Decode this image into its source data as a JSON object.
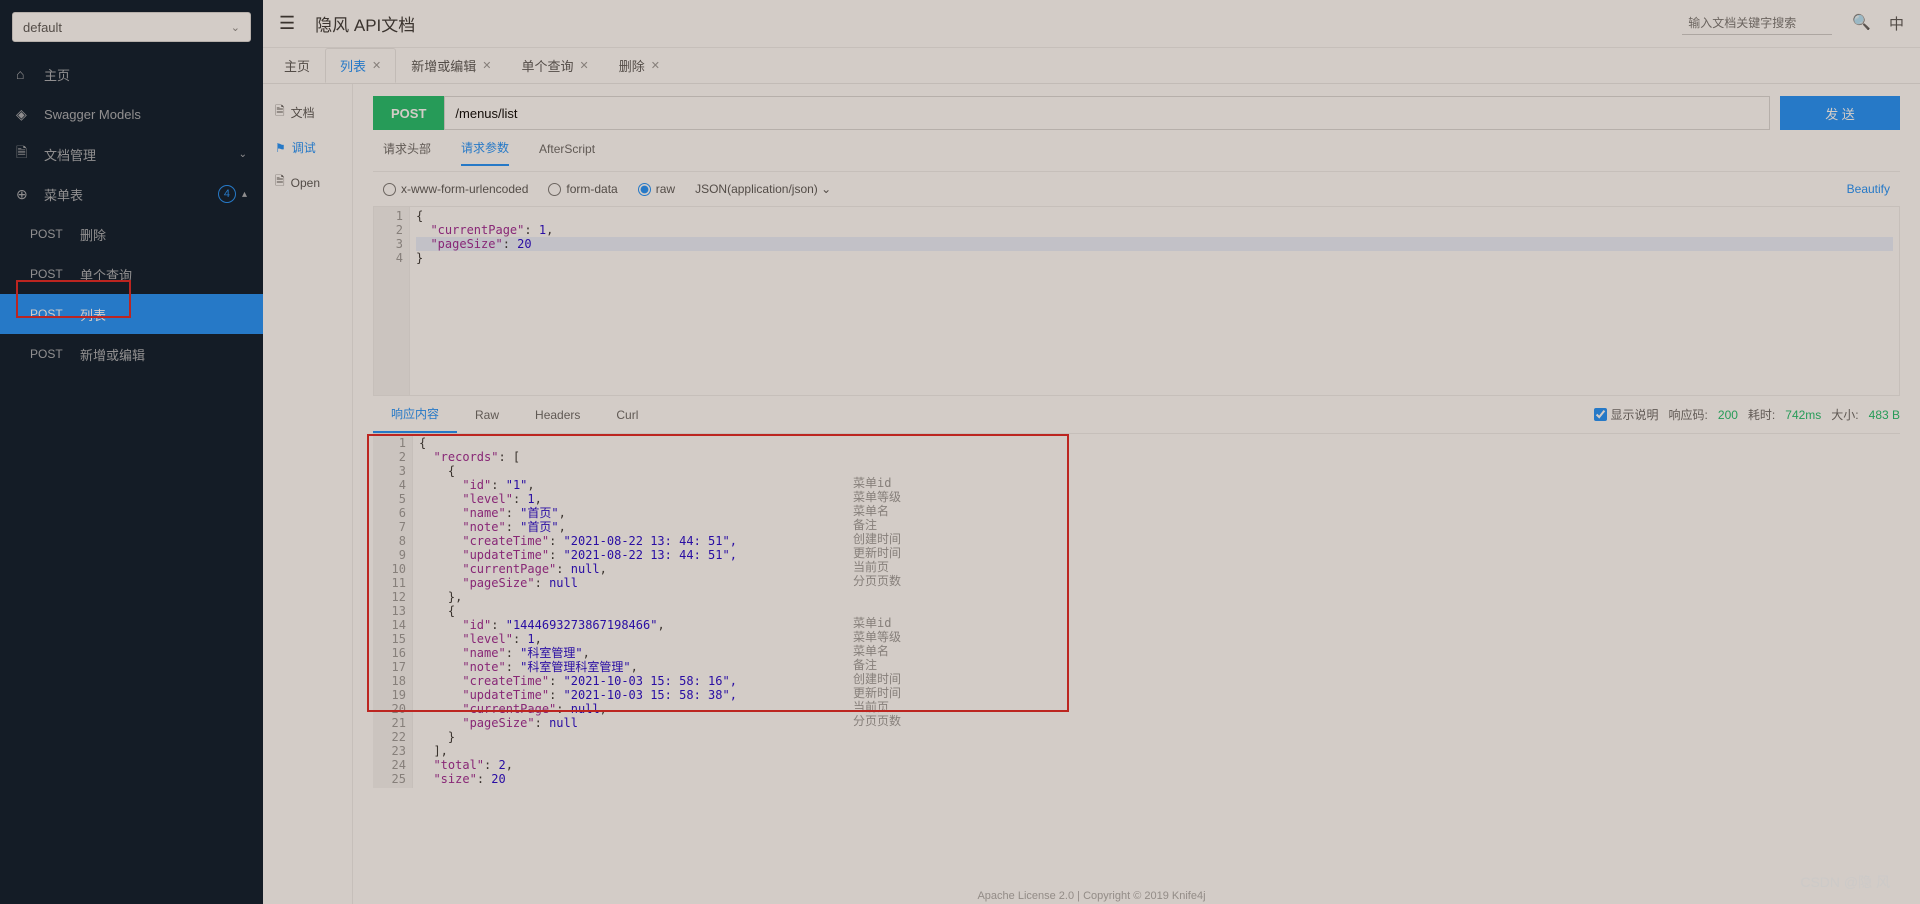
{
  "sidebar": {
    "selector": "default",
    "items": [
      {
        "icon": "⌂",
        "label": "主页"
      },
      {
        "icon": "◈",
        "label": "Swagger Models"
      },
      {
        "icon": "🗎",
        "label": "文档管理",
        "expandable": true
      },
      {
        "icon": "⊕",
        "label": "菜单表",
        "badge": "4",
        "expanded": true
      }
    ],
    "sub": [
      {
        "method": "POST",
        "label": "删除"
      },
      {
        "method": "POST",
        "label": "单个查询"
      },
      {
        "method": "POST",
        "label": "列表",
        "active": true
      },
      {
        "method": "POST",
        "label": "新增或编辑"
      }
    ]
  },
  "header": {
    "title": "隐风 API文档",
    "search_placeholder": "输入文档关键字搜索",
    "lang": "中"
  },
  "tabs": [
    {
      "label": "主页"
    },
    {
      "label": "列表",
      "closable": true,
      "active": true
    },
    {
      "label": "新增或编辑",
      "closable": true
    },
    {
      "label": "单个查询",
      "closable": true
    },
    {
      "label": "删除",
      "closable": true
    }
  ],
  "sub_sidebar": [
    {
      "icon": "🗎",
      "label": "文档"
    },
    {
      "icon": "⚑",
      "label": "调试",
      "active": true
    },
    {
      "icon": "🗎",
      "label": "Open"
    }
  ],
  "request": {
    "method": "POST",
    "url": "/menus/list",
    "send": "发 送",
    "param_tabs": [
      "请求头部",
      "请求参数",
      "AfterScript"
    ],
    "param_tab_active": 1,
    "body_types": [
      "x-www-form-urlencoded",
      "form-data",
      "raw"
    ],
    "body_type_selected": 2,
    "json_label": "JSON(application/json)",
    "beautify": "Beautify",
    "body_lines": [
      {
        "n": 1,
        "t": "{"
      },
      {
        "n": 2,
        "t": "  \"currentPage\": 1,"
      },
      {
        "n": 3,
        "t": "  \"pageSize\": 20",
        "hl": true
      },
      {
        "n": 4,
        "t": "}"
      }
    ]
  },
  "response": {
    "tabs": [
      "响应内容",
      "Raw",
      "Headers",
      "Curl"
    ],
    "tab_active": 0,
    "show_desc_label": "显示说明",
    "code_label": "响应码:",
    "code": "200",
    "time_label": "耗时:",
    "time": "742ms",
    "size_label": "大小:",
    "size": "483 B",
    "lines": [
      {
        "n": 1,
        "t": "{"
      },
      {
        "n": 2,
        "t": "  \"records\": ["
      },
      {
        "n": 3,
        "t": "    {"
      },
      {
        "n": 4,
        "t": "      \"id\": \"1\",",
        "d": "菜单id"
      },
      {
        "n": 5,
        "t": "      \"level\": 1,",
        "d": "菜单等级"
      },
      {
        "n": 6,
        "t": "      \"name\": \"首页\",",
        "d": "菜单名"
      },
      {
        "n": 7,
        "t": "      \"note\": \"首页\",",
        "d": "备注"
      },
      {
        "n": 8,
        "t": "      \"createTime\": \"2021-08-22 13:44:51\",",
        "d": "创建时间"
      },
      {
        "n": 9,
        "t": "      \"updateTime\": \"2021-08-22 13:44:51\",",
        "d": "更新时间"
      },
      {
        "n": 10,
        "t": "      \"currentPage\": null,",
        "d": "当前页"
      },
      {
        "n": 11,
        "t": "      \"pageSize\": null",
        "d": "分页页数"
      },
      {
        "n": 12,
        "t": "    },"
      },
      {
        "n": 13,
        "t": "    {"
      },
      {
        "n": 14,
        "t": "      \"id\": \"1444693273867198466\",",
        "d": "菜单id"
      },
      {
        "n": 15,
        "t": "      \"level\": 1,",
        "d": "菜单等级"
      },
      {
        "n": 16,
        "t": "      \"name\": \"科室管理\",",
        "d": "菜单名"
      },
      {
        "n": 17,
        "t": "      \"note\": \"科室管理科室管理\",",
        "d": "备注"
      },
      {
        "n": 18,
        "t": "      \"createTime\": \"2021-10-03 15:58:16\",",
        "d": "创建时间"
      },
      {
        "n": 19,
        "t": "      \"updateTime\": \"2021-10-03 15:58:38\",",
        "d": "更新时间"
      },
      {
        "n": 20,
        "t": "      \"currentPage\": null,",
        "d": "当前页"
      },
      {
        "n": 21,
        "t": "      \"pageSize\": null",
        "d": "分页页数"
      },
      {
        "n": 22,
        "t": "    }"
      },
      {
        "n": 23,
        "t": "  ],"
      },
      {
        "n": 24,
        "t": "  \"total\": 2,"
      },
      {
        "n": 25,
        "t": "  \"size\": 20"
      }
    ]
  },
  "watermark": "CSDN @隐 风",
  "footer": "Apache License 2.0 | Copyright © 2019 Knife4j"
}
